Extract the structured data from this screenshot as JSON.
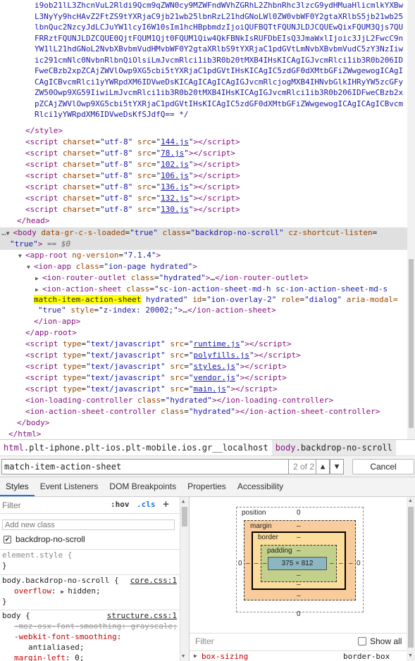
{
  "tree": {
    "base64_block": "i9ob21lL3ZhcnVuL2Rldi9Qcm9qZWN0cy9MZWFndWVhZGRhL2ZhbnRhc3lzcG9ydHMuaHlicmlkYXBwL3NyYy9hcHAvZ2FtZS9tYXRjaC9jb21wb25lbnRzL21hdGNoLWl0ZW0vbWF0Y2gtaXRlbS5jb21wb25lbnQuc2NzcyJdLCJuYW1lcyI6W10sIm1hcHBpbmdzIjoiQUFBQTtFQUNJLDJCQUEwQixFQUM3Qjs7QUFRRztFQUNJLDZCQUE0QjtFQUM1Qjt0FQUM1Qiw4QkFBNkIsRUFDbEIsQ3JmaWxlIjoic3JjL2FwcC9nYW1lL21hdGNoL2NvbXBvbmVudHMvbWF0Y2gtaXRlbS9tYXRjaC1pdGVtLmNvbXBvbmVudC5zY3NzIiwic291cmNlc0NvbnRlbnQiOlsiLmJvcmRlci1ib3R0b20tMXB4IHsKICAgIGJvcmRlci1ib3R0b206IDFweCBzb2xpZCAjZWVlOwp9XG5cbi5tYXRjaC1pdGVtIHsKICAgIC5zdGF0dXMtbGFiZWwgewogICAgICAgICBvcmRlci1yYWRpdXM6IDVweDsKICAgICAgICAgIGJvcmRlcjogMXB4IHNvbGlkIHRyYW5zcGFyZW50Owp9XG59IiwiLmJvcmRlci1ib3R0b20tMXB4IHsKICAgIGJvcmRlci1ib3R0b206IDFweCBzb2xpZCAjZWVlOwp9XG5cbi5tYXRjaC1pdGVtIHsKICAgIC5zdGF0dXMtbGFiZWwgewogICAgICAgICBvcmRlci1yYWRpdXM6IDVweDsKfSJdfQ== */",
    "style_close": "</style>",
    "scripts_head": [
      "144.js",
      "78.js",
      "102.js",
      "106.js",
      "136.js",
      "132.js",
      "130.js"
    ],
    "head_close": "</head>",
    "body_open_attrs": {
      "tag": "body",
      "attr1_name": "data-gr-c-s-loaded",
      "attr1_val": "\"true\"",
      "attr2_name": "class",
      "attr2_val": "\"backdrop-no-scroll\"",
      "attr3_name": "cz-shortcut-listen",
      "attr3_val": "\"true\"",
      "eq0": "== $0"
    },
    "app_root": {
      "tag": "app-root",
      "attr": "ng-version",
      "val": "\"7.1.4\""
    },
    "ion_app": {
      "tag": "ion-app",
      "attr": "class",
      "val": "\"ion-page hydrated\""
    },
    "ion_router_outlet": {
      "tag": "ion-router-outlet",
      "attr": "class",
      "val": "\"hydrated\"",
      "close": "</ion-router-outlet>"
    },
    "ion_action_sheet": {
      "tag": "ion-action-sheet",
      "class_attr": "class",
      "class_val_1": "\"sc-ion-action-sheet-md-h sc-ion-action-sheet-md-s",
      "match": "match-item-action-sheet",
      "class_val_2": " hydrated\"",
      "id_attr": "id",
      "id_val": "\"ion-overlay-2\"",
      "role_attr": "role",
      "role_val": "\"dialog\"",
      "aria_attr": "aria-modal=",
      "aria_val": "\"true\"",
      "style_attr": "style",
      "style_val": "\"z-index: 20002;\"",
      "close": "</ion-action-sheet>"
    },
    "ion_app_close": "</ion-app>",
    "app_root_close": "</app-root>",
    "scripts_body": [
      "runtime.js",
      "polyfills.js",
      "styles.js",
      "vendor.js",
      "main.js"
    ],
    "loading_controller": {
      "tag": "ion-loading-controller",
      "attr": "class",
      "val": "\"hydrated\"",
      "close": "</ion-loading-controller>"
    },
    "action_sheet_controller": {
      "tag": "ion-action-sheet-controller",
      "attr": "class",
      "val": "\"hydrated\"",
      "close": "</ion-action-sheet-controller>"
    },
    "body_close": "</body>",
    "html_close": "</html>"
  },
  "breadcrumb": {
    "items": [
      {
        "tag": "html",
        "rest": ".plt-iphone.plt-ios.plt-mobile.ios.gr__localhost"
      },
      {
        "tag": "body",
        "rest": ".backdrop-no-scroll"
      }
    ]
  },
  "search": {
    "value": "match-item-action-sheet",
    "count": "2 of 2",
    "up_label": "▲",
    "down_label": "▼",
    "cancel_label": "Cancel"
  },
  "tabs": [
    "Styles",
    "Event Listeners",
    "DOM Breakpoints",
    "Properties",
    "Accessibility"
  ],
  "styles": {
    "filter_placeholder": "Filter",
    "hov": ":hov",
    "cls": ".cls",
    "plus": "+",
    "add_class_placeholder": "Add new class",
    "class_checkbox": "✔",
    "class_name": "backdrop-no-scroll",
    "element_style_selector": "element.style {",
    "close_brace": "}",
    "rule1": {
      "selector": "body.backdrop-no-scroll {",
      "source": "core.css:1",
      "prop": "overflow",
      "value": "hidden;"
    },
    "rule2": {
      "selector": "body {",
      "source": "structure.css:1",
      "prop1": "-moz-osx-font-smoothing: grayscale;",
      "prop2": "-webkit-font-smoothing",
      "val2": "antialiased;",
      "prop3": "margin-left",
      "val3": "0;"
    }
  },
  "boxmodel": {
    "position_label": "position",
    "position_top": "0",
    "position_bottom": "0",
    "position_left": "0",
    "position_right": "0",
    "margin_label": "margin",
    "margin_value": "–",
    "border_label": "border",
    "border_value": "–",
    "padding_label": "padding",
    "padding_value": "–",
    "content": "375 × 812",
    "filter_placeholder": "Filter",
    "show_all": "Show all",
    "computed_prop": "box-sizing",
    "computed_val": "border-box"
  },
  "colors": {
    "tag": "#881280",
    "attr": "#994500",
    "value": "#1a1aa6",
    "match_highlight": "#ffff00",
    "margin": "#f9cc9d",
    "border": "#fddd9b",
    "padding": "#c3d08b",
    "content": "#8cb6c0"
  }
}
